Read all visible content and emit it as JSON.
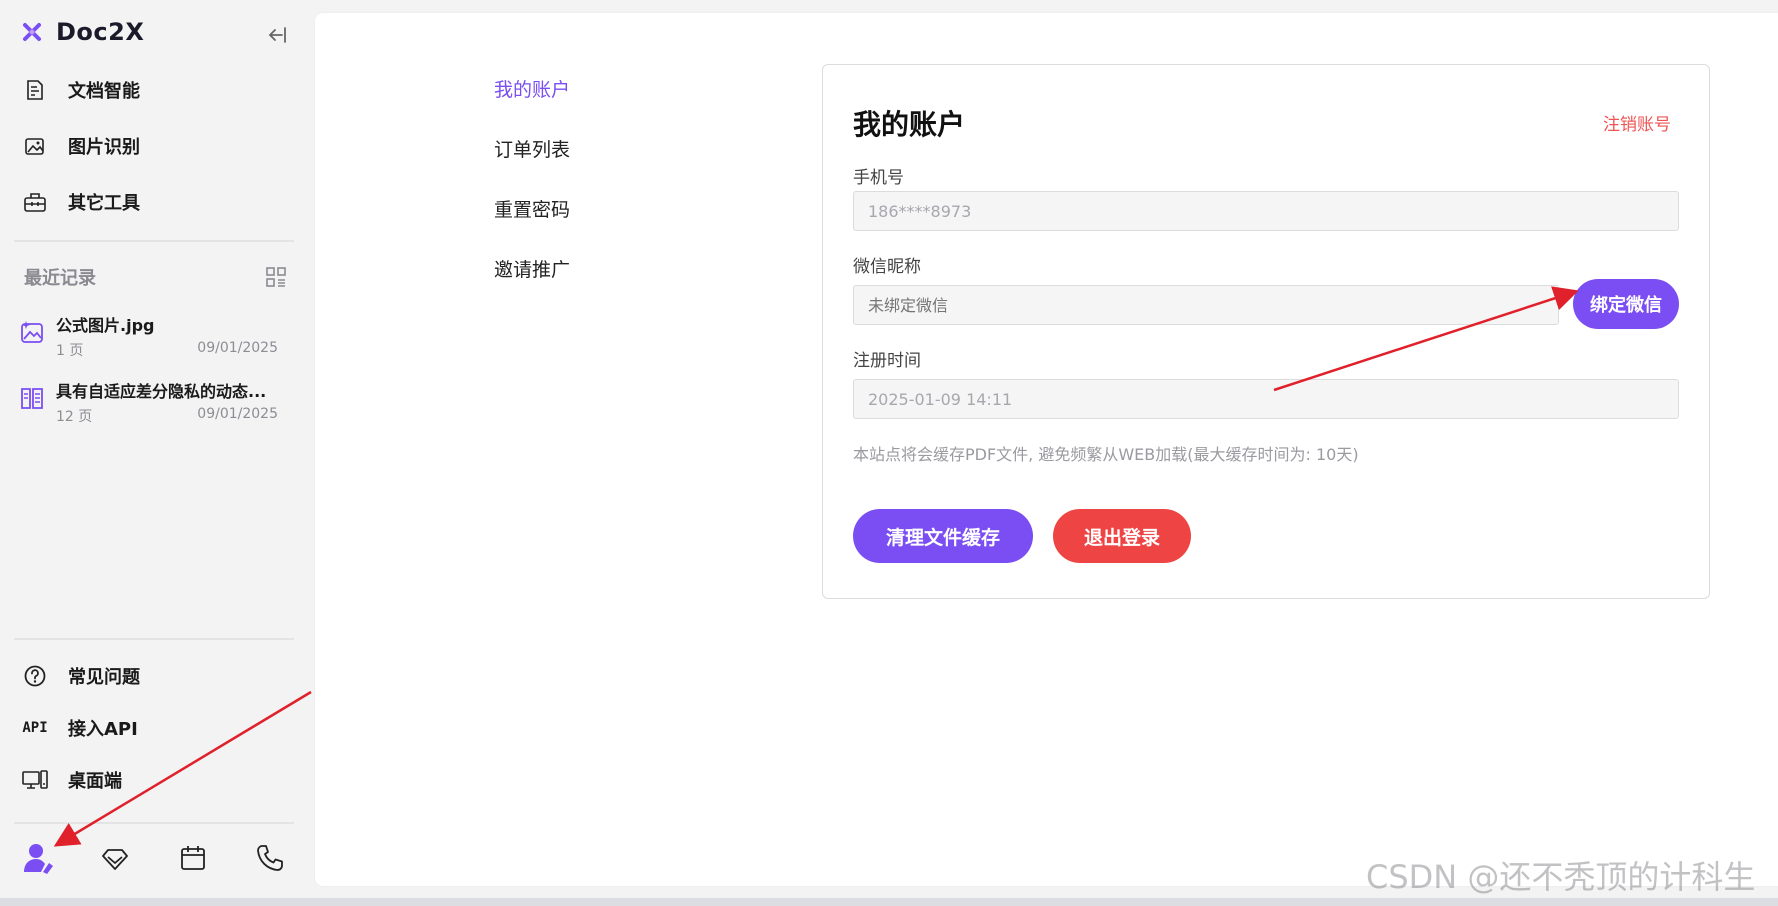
{
  "app": {
    "name": "Doc2X",
    "colors": {
      "accent": "#7a4ef2",
      "danger": "#ef4444",
      "link_danger": "#ef5454"
    }
  },
  "sidebar": {
    "collapse_icon": "collapse-left-icon",
    "nav": [
      {
        "label": "文档智能",
        "icon": "document-icon"
      },
      {
        "label": "图片识别",
        "icon": "image-scan-icon"
      },
      {
        "label": "其它工具",
        "icon": "toolbox-icon"
      }
    ],
    "recent": {
      "title": "最近记录",
      "items": [
        {
          "name": "公式图片.jpg",
          "pages": "1 页",
          "date": "09/01/2025",
          "icon": "image-file-icon"
        },
        {
          "name": "具有自适应差分隐私的动态...",
          "pages": "12 页",
          "date": "09/01/2025",
          "icon": "book-icon"
        }
      ]
    },
    "bottom_nav": [
      {
        "label": "常见问题",
        "icon": "help-circle-icon"
      },
      {
        "label": "接入API",
        "icon_text": "API"
      },
      {
        "label": "桌面端",
        "icon": "desktop-icon"
      }
    ],
    "dock": [
      "user-icon",
      "diamond-icon",
      "calendar-icon",
      "phone-icon"
    ]
  },
  "submenu": {
    "items": [
      "我的账户",
      "订单列表",
      "重置密码",
      "邀请推广"
    ],
    "active_index": 0
  },
  "account": {
    "title": "我的账户",
    "cancel_account": "注销账号",
    "phone": {
      "label": "手机号",
      "value": "186****8973"
    },
    "wechat": {
      "label": "微信昵称",
      "placeholder": "未绑定微信",
      "bind_button": "绑定微信"
    },
    "registered": {
      "label": "注册时间",
      "value": "2025-01-09 14:11"
    },
    "note": "本站点将会缓存PDF文件, 避免频繁从WEB加载(最大缓存时间为: 10天)",
    "clear_cache_button": "清理文件缓存",
    "logout_button": "退出登录"
  },
  "watermark": "CSDN @还不秃顶的计科生"
}
